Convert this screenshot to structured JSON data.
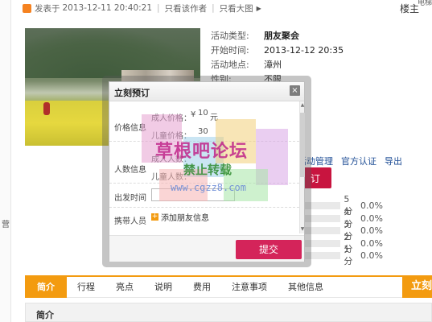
{
  "post": {
    "published_prefix": "发表于",
    "published_time": "2013-12-11 20:40:21",
    "only_author": "只看该作者",
    "view_large": "只看大图",
    "owner": "楼主",
    "owner_sup": "电梯"
  },
  "activity": {
    "rows": [
      {
        "k": "活动类型:",
        "v": "朋友聚会",
        "bold": true
      },
      {
        "k": "开始时间:",
        "v": "2013-12-12 20:35"
      },
      {
        "k": "活动地点:",
        "v": "漳州"
      },
      {
        "k": "性别:",
        "v": "不限"
      }
    ]
  },
  "booking": {
    "actions": [
      "活动管理",
      "官方认证",
      "导出"
    ],
    "button": "订"
  },
  "ratings": [
    {
      "label": "5分",
      "pct": "0.0%"
    },
    {
      "label": "4分",
      "pct": "0.0%"
    },
    {
      "label": "3分",
      "pct": "0.0%"
    },
    {
      "label": "2分",
      "pct": "0.0%"
    },
    {
      "label": "1分",
      "pct": "0.0%"
    }
  ],
  "modal": {
    "title": "立刻预订",
    "close": "×",
    "price_label": "价格信息",
    "adult_price_label": "成人价格：",
    "adult_price_currency": "¥",
    "adult_price_value": "10",
    "adult_price_unit": "元",
    "child_price_label": "儿童价格：",
    "child_price_value": "30",
    "people_label": "人数信息",
    "adult_count_label": "成人人数：",
    "child_count_label": "儿童人数：",
    "date_label": "出发时间",
    "companion_label": "携带人员",
    "add_friend": "添加朋友信息",
    "submit": "提交"
  },
  "watermark": {
    "title": "草根吧论坛",
    "sub": "禁止转载",
    "url": "www.cgzz8.com"
  },
  "tabs": [
    "简介",
    "行程",
    "亮点",
    "说明",
    "费用",
    "注意事项",
    "其他信息"
  ],
  "tab_cta": "立刻预订",
  "section_title": "简介",
  "left_rail_mark": "营"
}
